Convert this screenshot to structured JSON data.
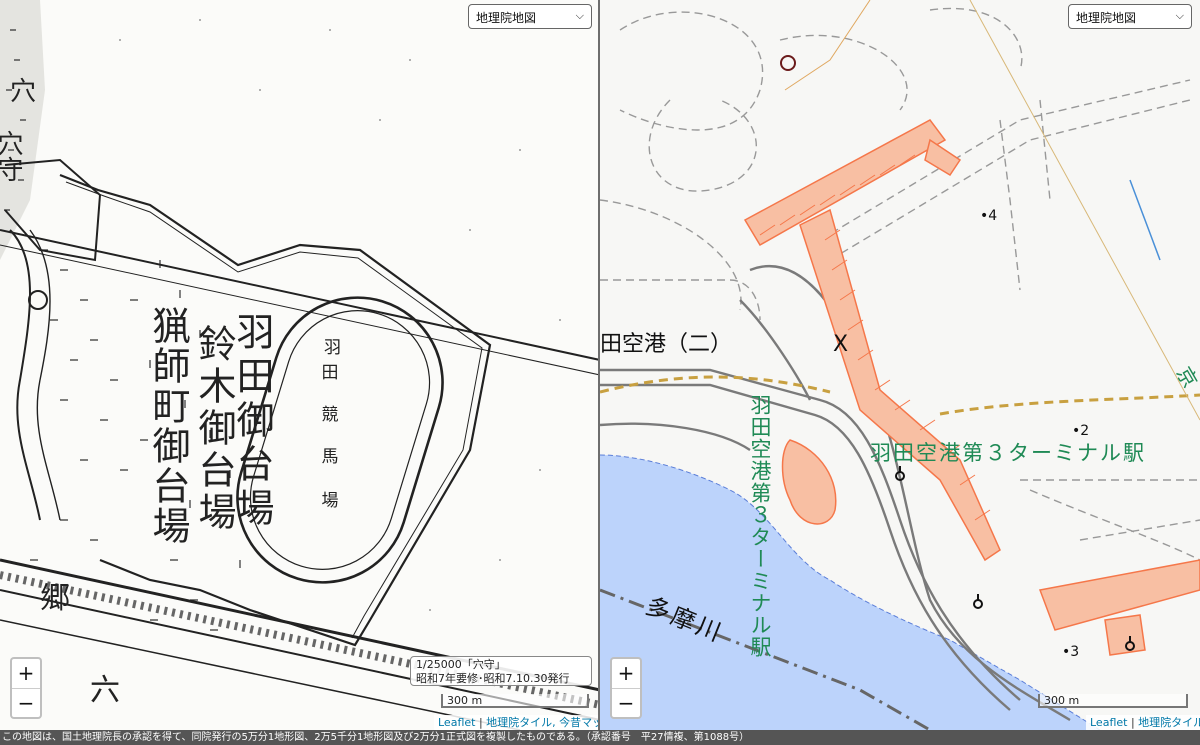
{
  "left_map": {
    "layer_select": "地理院地図",
    "map_labels": {
      "station": "穴守",
      "station_top": "穴",
      "racecourse_1": "羽",
      "racecourse_2": "田",
      "racecourse_3": "競",
      "racecourse_4": "馬",
      "racecourse_5": "場",
      "daiba_1": "羽田御台場",
      "daiba_2": "鈴木御台場",
      "daiba_3": "猟師町御台場",
      "daiba_2_tail": "場",
      "bottom_1": "郷",
      "bottom_2": "六"
    },
    "map_info_line1": "1/25000「穴守」",
    "map_info_line2": "昭和7年要修･昭和7.10.30発行",
    "scale": "300 m",
    "zoom_in": "+",
    "zoom_out": "−",
    "attribution": {
      "leaflet": "Leaflet",
      "sep": " | ",
      "tile": "地理院タイル, 今昔マップ"
    }
  },
  "right_map": {
    "layer_select": "地理院地図",
    "map_labels": {
      "airport": "田空港（二）",
      "terminal_station_h": "羽田空港第３ターミナル駅",
      "terminal_station_v": "羽田空港第３ターミナル駅",
      "river": "多摩川",
      "kei": "京",
      "police_mark": "X",
      "height_4": "4",
      "height_2": "2",
      "height_3": "3"
    },
    "scale": "300 m",
    "zoom_in": "+",
    "zoom_out": "−",
    "attribution": {
      "leaflet": "Leaflet",
      "sep": " | ",
      "tile": "地理院タイル"
    }
  },
  "footer": "この地図は、国土地理院長の承認を得て、同院発行の5万分1地形図、2万5千分1地形図及び2万分1正式図を複製したものである。（承認番号　平27情複、第1088号）",
  "colors": {
    "old_map_ink": "#222222",
    "water": "#bcd3fb",
    "airport_fill": "#f5a07a",
    "railway_label": "#1f8a55",
    "boundary_dash": "#c8a040"
  }
}
